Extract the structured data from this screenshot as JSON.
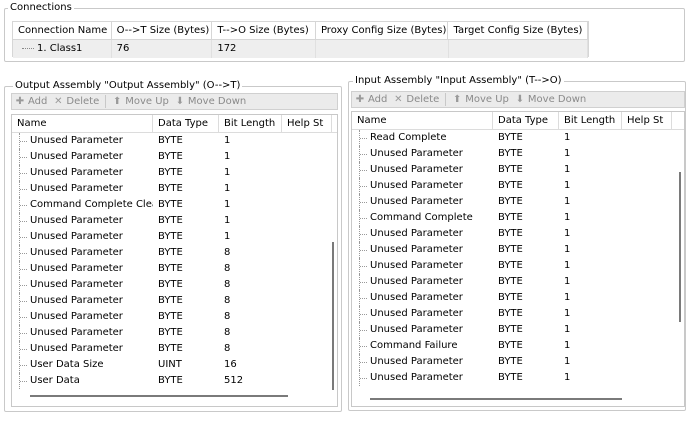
{
  "connections": {
    "title": "Connections",
    "columns": [
      "Connection Name",
      "O-->T Size (Bytes)",
      "T-->O Size (Bytes)",
      "Proxy Config Size (Bytes)",
      "Target Config Size (Bytes)"
    ],
    "row": {
      "name": "1. Class1",
      "ot_size": "76",
      "to_size": "172",
      "proxy": "",
      "target": ""
    }
  },
  "output": {
    "title": "Output Assembly \"Output Assembly\" (O-->T)",
    "toolbar": {
      "add": "Add",
      "delete": "Delete",
      "move_up": "Move Up",
      "move_down": "Move Down"
    },
    "columns": [
      "Name",
      "Data Type",
      "Bit Length",
      "Help St"
    ],
    "rows": [
      {
        "name": "Unused Parameter",
        "type": "BYTE",
        "bits": "1"
      },
      {
        "name": "Unused Parameter",
        "type": "BYTE",
        "bits": "1"
      },
      {
        "name": "Unused Parameter",
        "type": "BYTE",
        "bits": "1"
      },
      {
        "name": "Unused Parameter",
        "type": "BYTE",
        "bits": "1"
      },
      {
        "name": "Command Complete Clear",
        "type": "BYTE",
        "bits": "1"
      },
      {
        "name": "Unused Parameter",
        "type": "BYTE",
        "bits": "1"
      },
      {
        "name": "Unused Parameter",
        "type": "BYTE",
        "bits": "1"
      },
      {
        "name": "Unused Parameter",
        "type": "BYTE",
        "bits": "8"
      },
      {
        "name": "Unused Parameter",
        "type": "BYTE",
        "bits": "8"
      },
      {
        "name": "Unused Parameter",
        "type": "BYTE",
        "bits": "8"
      },
      {
        "name": "Unused Parameter",
        "type": "BYTE",
        "bits": "8"
      },
      {
        "name": "Unused Parameter",
        "type": "BYTE",
        "bits": "8"
      },
      {
        "name": "Unused Parameter",
        "type": "BYTE",
        "bits": "8"
      },
      {
        "name": "Unused Parameter",
        "type": "BYTE",
        "bits": "8"
      },
      {
        "name": "User Data Size",
        "type": "UINT",
        "bits": "16"
      },
      {
        "name": "User Data",
        "type": "BYTE",
        "bits": "512"
      }
    ]
  },
  "input": {
    "title": "Input Assembly \"Input Assembly\" (T-->O)",
    "toolbar": {
      "add": "Add",
      "delete": "Delete",
      "move_up": "Move Up",
      "move_down": "Move Down"
    },
    "columns": [
      "Name",
      "Data Type",
      "Bit Length",
      "Help St"
    ],
    "rows": [
      {
        "name": "Read Complete",
        "type": "BYTE",
        "bits": "1"
      },
      {
        "name": "Unused Parameter",
        "type": "BYTE",
        "bits": "1"
      },
      {
        "name": "Unused Parameter",
        "type": "BYTE",
        "bits": "1"
      },
      {
        "name": "Unused Parameter",
        "type": "BYTE",
        "bits": "1"
      },
      {
        "name": "Unused Parameter",
        "type": "BYTE",
        "bits": "1"
      },
      {
        "name": "Command Complete",
        "type": "BYTE",
        "bits": "1"
      },
      {
        "name": "Unused Parameter",
        "type": "BYTE",
        "bits": "1"
      },
      {
        "name": "Unused Parameter",
        "type": "BYTE",
        "bits": "1"
      },
      {
        "name": "Unused Parameter",
        "type": "BYTE",
        "bits": "1"
      },
      {
        "name": "Unused Parameter",
        "type": "BYTE",
        "bits": "1"
      },
      {
        "name": "Unused Parameter",
        "type": "BYTE",
        "bits": "1"
      },
      {
        "name": "Unused Parameter",
        "type": "BYTE",
        "bits": "1"
      },
      {
        "name": "Unused Parameter",
        "type": "BYTE",
        "bits": "1"
      },
      {
        "name": "Command Failure",
        "type": "BYTE",
        "bits": "1"
      },
      {
        "name": "Unused Parameter",
        "type": "BYTE",
        "bits": "1"
      },
      {
        "name": "Unused Parameter",
        "type": "BYTE",
        "bits": "1"
      }
    ]
  },
  "icons": {
    "add": "plus-icon",
    "delete": "x-delete-icon",
    "move_up": "arrow-up-icon",
    "move_down": "arrow-down-icon"
  }
}
